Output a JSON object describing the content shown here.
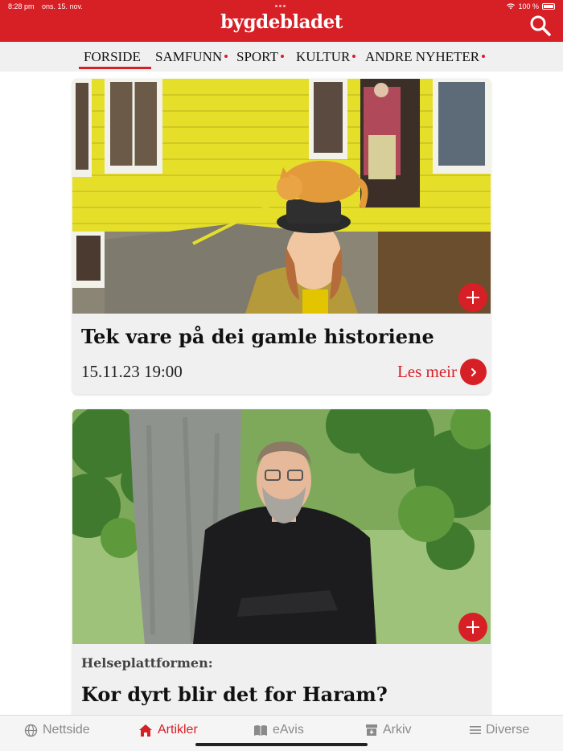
{
  "status_bar": {
    "time": "8:28 pm",
    "date": "ons. 15. nov.",
    "battery": "100 %"
  },
  "header": {
    "logo": "bygdebladet",
    "search_icon": "search-icon"
  },
  "nav": {
    "items": [
      {
        "label": "FORSIDE",
        "active": true,
        "dot": false
      },
      {
        "label": "SAMFUNN",
        "active": false,
        "dot": true
      },
      {
        "label": "SPORT",
        "active": false,
        "dot": true
      },
      {
        "label": "KULTUR",
        "active": false,
        "dot": true
      },
      {
        "label": "ANDRE NYHETER",
        "active": false,
        "dot": true
      }
    ]
  },
  "articles": [
    {
      "title": "Tek vare på dei gamle historiene",
      "date": "15.11.23 19:00",
      "read_more": "Les meir"
    },
    {
      "kicker": "Helseplattformen:",
      "title": "Kor dyrt blir det for Haram?"
    }
  ],
  "tabbar": {
    "tabs": [
      {
        "label": "Nettside",
        "icon": "globe-icon",
        "active": false
      },
      {
        "label": "Artikler",
        "icon": "home-icon",
        "active": true
      },
      {
        "label": "eAvis",
        "icon": "book-icon",
        "active": false
      },
      {
        "label": "Arkiv",
        "icon": "archive-icon",
        "active": false
      },
      {
        "label": "Diverse",
        "icon": "menu-icon",
        "active": false
      }
    ]
  },
  "colors": {
    "brand": "#d71f26",
    "nav_bg": "#f0f0f0",
    "inactive_tab": "#8a8a8a"
  }
}
